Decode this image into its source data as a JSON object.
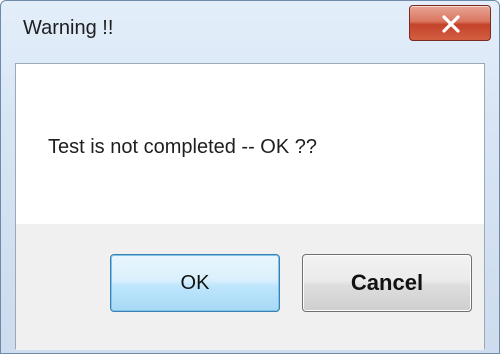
{
  "window": {
    "title": "Warning !!",
    "close_icon": "close-icon"
  },
  "dialog": {
    "message": "Test is not completed -- OK ??"
  },
  "buttons": {
    "ok_label": "OK",
    "cancel_label": "Cancel"
  },
  "colors": {
    "close_button": "#c4432b",
    "ok_button_border": "#3c7fb1"
  }
}
